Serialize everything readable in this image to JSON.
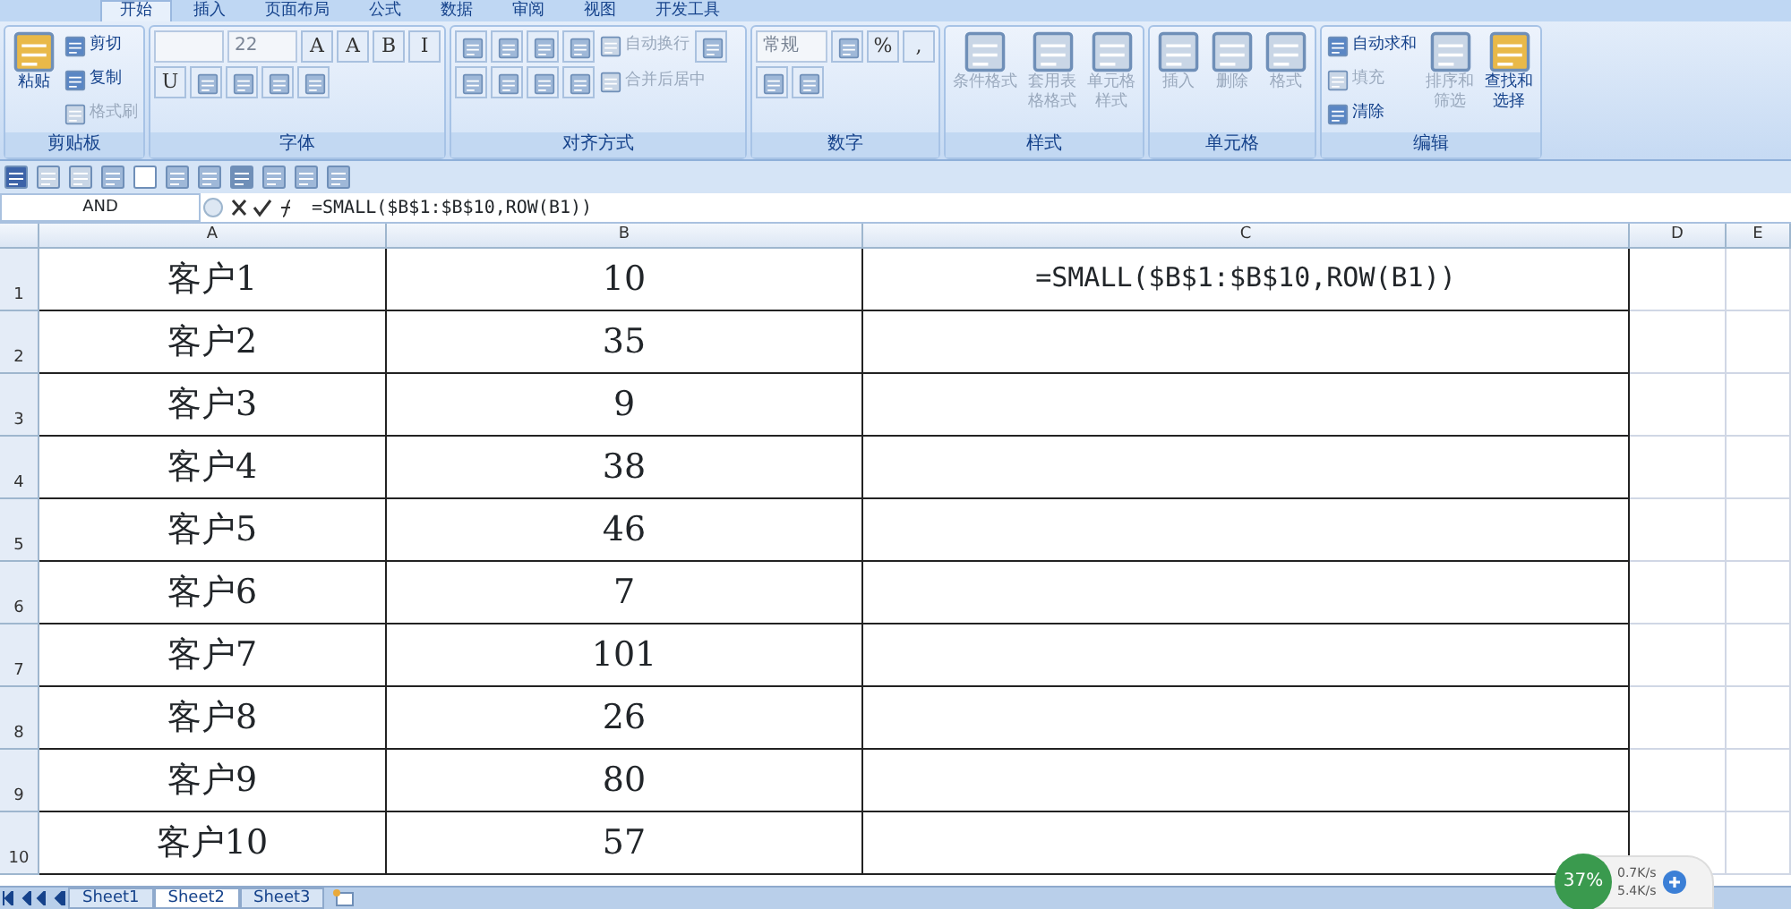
{
  "ribbon_tabs": [
    {
      "label": "开始",
      "selected": true
    },
    {
      "label": "插入",
      "selected": false
    },
    {
      "label": "页面布局",
      "selected": false
    },
    {
      "label": "公式",
      "selected": false
    },
    {
      "label": "数据",
      "selected": false
    },
    {
      "label": "审阅",
      "selected": false
    },
    {
      "label": "视图",
      "selected": false
    },
    {
      "label": "开发工具",
      "selected": false
    }
  ],
  "ribbon_groups": [
    {
      "label": "剪贴板",
      "items": [
        {
          "kind": "large",
          "label": "粘贴",
          "disabled": false
        },
        {
          "kind": "small",
          "label": "剪切",
          "disabled": false
        },
        {
          "kind": "small",
          "label": "复制",
          "disabled": false
        },
        {
          "kind": "small",
          "label": "格式刷",
          "disabled": true
        }
      ]
    },
    {
      "label": "字体",
      "items": [
        {
          "kind": "combo"
        },
        {
          "kind": "combo",
          "value": "22"
        },
        {
          "kind": "glyph",
          "label": "A"
        },
        {
          "kind": "glyph",
          "label": "A"
        },
        {
          "kind": "glyph",
          "label": "B"
        },
        {
          "kind": "glyph",
          "label": "I"
        },
        {
          "kind": "glyph",
          "label": "U"
        },
        {
          "kind": "iconbtn"
        },
        {
          "kind": "iconbtn"
        },
        {
          "kind": "iconbtn"
        },
        {
          "kind": "iconbtn"
        }
      ]
    },
    {
      "label": "对齐方式",
      "items": [
        {
          "kind": "iconbtn"
        },
        {
          "kind": "iconbtn"
        },
        {
          "kind": "iconbtn"
        },
        {
          "kind": "iconbtn"
        },
        {
          "kind": "small",
          "label": "自动换行",
          "disabled": true
        },
        {
          "kind": "iconbtn"
        },
        {
          "kind": "iconbtn"
        },
        {
          "kind": "iconbtn"
        },
        {
          "kind": "iconbtn"
        },
        {
          "kind": "iconbtn"
        },
        {
          "kind": "small",
          "label": "合并后居中",
          "disabled": true
        }
      ]
    },
    {
      "label": "数字",
      "items": [
        {
          "kind": "combo",
          "value": "常规"
        },
        {
          "kind": "iconbtn"
        },
        {
          "kind": "glyph",
          "label": "%"
        },
        {
          "kind": "glyph",
          "label": ","
        },
        {
          "kind": "iconbtn"
        },
        {
          "kind": "iconbtn"
        }
      ]
    },
    {
      "label": "样式",
      "items": [
        {
          "kind": "large",
          "label": "条件格式",
          "disabled": true
        },
        {
          "kind": "large",
          "label": "套用表格格式",
          "disabled": true
        },
        {
          "kind": "large",
          "label": "单元格样式",
          "disabled": true
        }
      ]
    },
    {
      "label": "单元格",
      "items": [
        {
          "kind": "large",
          "label": "插入",
          "disabled": true
        },
        {
          "kind": "large",
          "label": "删除",
          "disabled": true
        },
        {
          "kind": "large",
          "label": "格式",
          "disabled": true
        }
      ]
    },
    {
      "label": "编辑",
      "items": [
        {
          "kind": "small",
          "label": "自动求和",
          "disabled": false
        },
        {
          "kind": "small",
          "label": "填充",
          "disabled": true
        },
        {
          "kind": "small",
          "label": "清除",
          "disabled": false
        },
        {
          "kind": "large",
          "label": "排序和筛选",
          "disabled": true
        },
        {
          "kind": "large",
          "label": "查找和选择",
          "disabled": false
        }
      ]
    }
  ],
  "formula_bar": {
    "name_box": "AND",
    "formula": "=SMALL($B$1:$B$10,ROW(B1))"
  },
  "columns": [
    "A",
    "B",
    "C",
    "D",
    "E"
  ],
  "rows": [
    {
      "number": "1",
      "cells": [
        "客户1",
        "10",
        "=SMALL($B$1:$B$10,ROW(B1))"
      ]
    },
    {
      "number": "2",
      "cells": [
        "客户2",
        "35"
      ]
    },
    {
      "number": "3",
      "cells": [
        "客户3",
        "9"
      ]
    },
    {
      "number": "4",
      "cells": [
        "客户4",
        "38"
      ]
    },
    {
      "number": "5",
      "cells": [
        "客户5",
        "46"
      ]
    },
    {
      "number": "6",
      "cells": [
        "客户6",
        "7"
      ]
    },
    {
      "number": "7",
      "cells": [
        "客户7",
        "101"
      ]
    },
    {
      "number": "8",
      "cells": [
        "客户8",
        "26"
      ]
    },
    {
      "number": "9",
      "cells": [
        "客户9",
        "80"
      ]
    },
    {
      "number": "10",
      "cells": [
        "客户10",
        "57"
      ]
    }
  ],
  "sheet_tabs": [
    {
      "label": "Sheet1",
      "selected": false
    },
    {
      "label": "Sheet2",
      "selected": true
    },
    {
      "label": "Sheet3",
      "selected": false
    }
  ],
  "net_widget": {
    "percent": "37%",
    "upload": "0.7K/s",
    "download": "5.4K/s"
  }
}
